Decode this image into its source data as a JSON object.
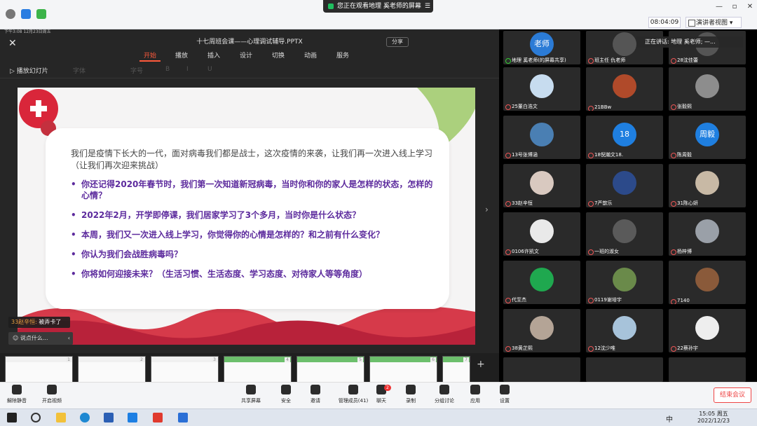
{
  "topbar": {
    "watching": "您正在观看地理 奚老师的屏幕",
    "timer": "08:04:09",
    "presenter_view": "演讲者视图",
    "window_controls": [
      "—",
      "▫",
      "✕"
    ]
  },
  "slide_app": {
    "status_time": "下午3:08  12月23日周五",
    "title": "十七周班会课——心理调试辅导.PPTX",
    "share": "分享",
    "tabs": [
      "开始",
      "播放",
      "插入",
      "设计",
      "切换",
      "动画",
      "服务"
    ],
    "play_from_current": "播放幻灯片",
    "font_placeholder": "字体",
    "size_placeholder": "字号"
  },
  "slide": {
    "intro": "我们是疫情下长大的一代，面对病毒我们都是战士，这次疫情的来袭，让我们再一次进入线上学习（让我们再次迎来挑战）",
    "bullets": [
      "你还记得2020年春节时，我们第一次知道新冠病毒，当时你和你的家人是怎样的状态，怎样的心情？",
      "2022年2月，开学即停课，我们居家学习了3个多月，当时你是什么状态？",
      "本周，我们又一次进入线上学习，你觉得你的心情是怎样的？和之前有什么变化？",
      "你认为我们会战胜病毒吗？",
      "你将如何迎接未来？（生活习惯、生活态度、学习态度、对待家人等等角度）"
    ]
  },
  "chat": {
    "popup_name": "33赵辛恒:",
    "popup_text": "被弄卡了",
    "input_placeholder": "说点什么..."
  },
  "thumbs": [
    "1",
    "2",
    "3",
    "4",
    "5",
    "6",
    "7"
  ],
  "video_grid": {
    "speaking": "正在讲话: 地理 奚老师; —...",
    "tiles": [
      {
        "label": "地理 奚老师(的屏幕共享)",
        "avatar": "老师",
        "color": "#2b7bd6",
        "on": true
      },
      {
        "label": "班主任 仇老师",
        "avatar": "",
        "color": "#555",
        "on": false
      },
      {
        "label": "28沈佳蕾",
        "avatar": "",
        "color": "#555",
        "on": false
      },
      {
        "label": "25董白浩文",
        "avatar": "",
        "color": "#c7dcef",
        "on": false
      },
      {
        "label": "21BBw",
        "avatar": "",
        "color": "#b04a2a",
        "on": false
      },
      {
        "label": "张毅熙",
        "avatar": "",
        "color": "#8d8d8d",
        "on": false
      },
      {
        "label": "13号张博涵",
        "avatar": "",
        "color": "#4a7fb3",
        "on": false
      },
      {
        "label": "18倪瀚文18.",
        "avatar": "18",
        "color": "#1f7fe0",
        "on": false
      },
      {
        "label": "陈周毅",
        "avatar": "周毅",
        "color": "#1f7fe0",
        "on": false
      },
      {
        "label": "33赵辛恒",
        "avatar": "",
        "color": "#d9c9c0",
        "on": false
      },
      {
        "label": "7严歆乐",
        "avatar": "",
        "color": "#2c4a8a",
        "on": false
      },
      {
        "label": "31陈心妍",
        "avatar": "",
        "color": "#c8b9a5",
        "on": false
      },
      {
        "label": "0106许凯文",
        "avatar": "",
        "color": "#e9e9e9",
        "on": false
      },
      {
        "label": "一班的淑女",
        "avatar": "",
        "color": "#5a5a5a",
        "on": false
      },
      {
        "label": "杨梓博",
        "avatar": "",
        "color": "#9aa0a8",
        "on": false
      },
      {
        "label": "代至杰",
        "avatar": "",
        "color": "#1fa84f",
        "on": false
      },
      {
        "label": "0119谢培宇",
        "avatar": "",
        "color": "#6a8a4a",
        "on": false
      },
      {
        "label": "7140",
        "avatar": "",
        "color": "#8a5a3a",
        "on": false
      },
      {
        "label": "38黄芷熙",
        "avatar": "",
        "color": "#b4a496",
        "on": false
      },
      {
        "label": "12沈少唯",
        "avatar": "",
        "color": "#a7c3da",
        "on": false
      },
      {
        "label": "22蔡孙宇",
        "avatar": "",
        "color": "#eeeeee",
        "on": false
      }
    ]
  },
  "meet_bar": {
    "buttons": [
      {
        "label": "解除静音",
        "icon": "mic-off-icon"
      },
      {
        "label": "开启视频",
        "icon": "video-off-icon"
      },
      {
        "label": "共享屏幕",
        "icon": "share-screen-icon"
      },
      {
        "label": "安全",
        "icon": "shield-icon"
      },
      {
        "label": "邀请",
        "icon": "invite-icon"
      },
      {
        "label": "管理成员(41)",
        "icon": "members-icon"
      },
      {
        "label": "聊天",
        "icon": "chat-icon"
      },
      {
        "label": "录制",
        "icon": "record-icon"
      },
      {
        "label": "分组讨论",
        "icon": "breakout-icon"
      },
      {
        "label": "应用",
        "icon": "apps-icon"
      },
      {
        "label": "设置",
        "icon": "gear-icon"
      }
    ],
    "chat_badge": "2",
    "end_meeting": "结束会议"
  },
  "taskbar": {
    "ime": "中",
    "time": "15:05 周五",
    "date": "2022/12/23"
  }
}
